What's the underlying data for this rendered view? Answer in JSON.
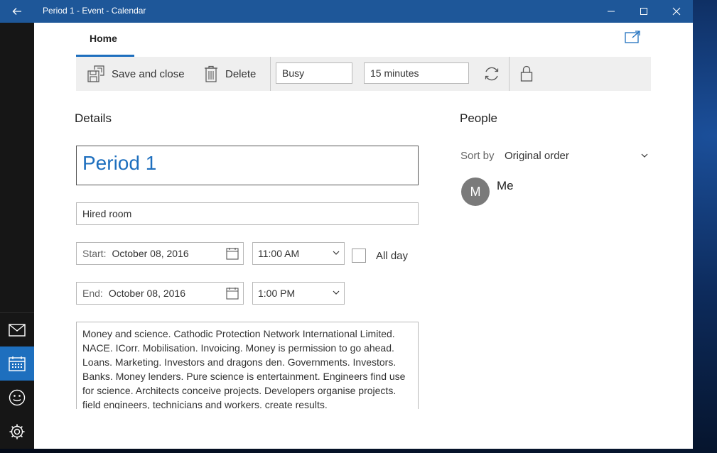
{
  "window": {
    "title": "Period 1 - Event - Calendar"
  },
  "tabs": [
    {
      "label": "Home"
    }
  ],
  "toolbar": {
    "save_label": "Save and close",
    "delete_label": "Delete",
    "show_as": "Busy",
    "reminder": "15 minutes"
  },
  "details": {
    "heading": "Details",
    "event_title": "Period 1",
    "location": "Hired room",
    "start_prefix": "Start:",
    "start_date": "October 08, 2016",
    "start_time": "11:00 AM",
    "end_prefix": "End:",
    "end_date": "October 08, 2016",
    "end_time": "1:00 PM",
    "all_day_label": "All day",
    "all_day_checked": false,
    "notes": [
      "Money and science.  Cathodic Protection Network International Limited.",
      "NACE.  ICorr. Mobilisation. Invoicing. Money is permission to go ahead.",
      "Loans. Marketing. Investors and dragons den.  Governments. Investors.",
      "Banks. Money lenders. Pure science is entertainment. Engineers find use",
      "for science. Architects conceive projects. Developers organise projects.",
      "field engineers, technicians and workers. create results."
    ]
  },
  "people": {
    "heading": "People",
    "sort_label": "Sort by",
    "sort_value": "Original order",
    "attendees": [
      {
        "initial": "M",
        "name": "Me"
      }
    ]
  },
  "colors": {
    "accent": "#1e6fbe",
    "titlebar": "#1e5799",
    "rail": "#161616"
  }
}
